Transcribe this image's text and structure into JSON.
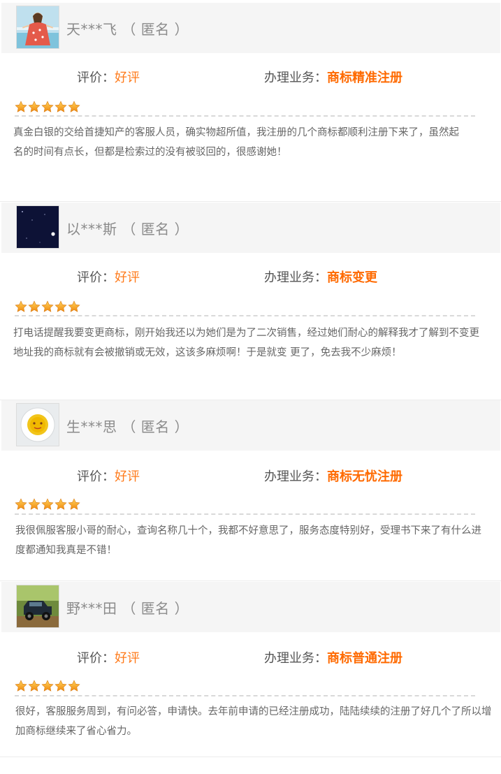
{
  "labels": {
    "rating": "评价：",
    "business": "办理业务："
  },
  "colors": {
    "accent": "#ff6a00",
    "header_bg": "#f5f5f5",
    "star": "#f7a21b"
  },
  "reviews": [
    {
      "user": "天***飞 （ 匿名 ）",
      "avatar_icon": "girl-avatar-icon",
      "rating": "好评",
      "stars": 5,
      "business": "商标精准注册",
      "comment": "真金白银的交给首捷知产的客服人员，确实物超所值，我注册的几个商标都顺利注册下来了，虽然起名的时间有点长，但都是检索过的没有被驳回的，很感谢她！"
    },
    {
      "user": "以***斯 （ 匿名 ）",
      "avatar_icon": "night-sky-avatar-icon",
      "rating": "好评",
      "stars": 5,
      "business": "商标变更",
      "comment": "打电话提醒我要变更商标，刚开始我还以为她们是为了二次销售，经过她们耐心的解释我才了解到不变更地址我的商标就有会被撤销或无效，这该多麻烦啊！于是就变 更了，免去我不少麻烦！"
    },
    {
      "user": "生***思 （ 匿名 ）",
      "avatar_icon": "tea-cup-avatar-icon",
      "rating": "好评",
      "stars": 5,
      "business": "商标无忧注册",
      "comment": "我很佩服客服小哥的耐心，查询名称几十个，我都不好意思了，服务态度特别好，受理书下来了有什么进度都通知我真是不错！"
    },
    {
      "user": "野***田 （ 匿名 ）",
      "avatar_icon": "jeep-avatar-icon",
      "rating": "好评",
      "stars": 5,
      "business": "商标普通注册",
      "comment": "很好，客服服务周到，有问必答，申请快。去年前申请的已经注册成功，陆陆续续的注册了好几个了所以增加商标继续来了省心省力。"
    }
  ]
}
